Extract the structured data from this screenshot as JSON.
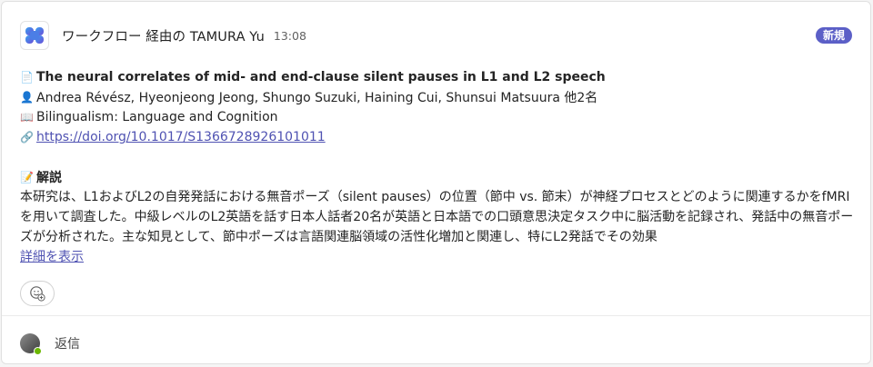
{
  "header": {
    "sender": "ワークフロー 経由の TAMURA Yu",
    "time": "13:08",
    "badge": "新規",
    "app_icon": "workflow-app-icon"
  },
  "paper": {
    "title_icon": "📄",
    "title": "The neural correlates of mid- and end-clause silent pauses in L1 and L2 speech",
    "authors_icon": "👤",
    "authors": "Andrea Révész, Hyeonjeong Jeong, Shungo Suzuki, Haining Cui, Shunsui Matsuura 他2名",
    "journal_icon": "📖",
    "journal": "Bilingualism: Language and Cognition",
    "link_icon": "🔗",
    "doi": "https://doi.org/10.1017/S1366728926101011"
  },
  "summary": {
    "heading_icon": "📝",
    "heading": "解説",
    "text": "本研究は、L1およびL2の自発発話における無音ポーズ（silent pauses）の位置（節中 vs. 節末）が神経プロセスとどのように関連するかをfMRIを用いて調査した。中級レベルのL2英語を話す日本人話者20名が英語と日本語での口頭意思決定タスク中に脳活動を記録され、発話中の無音ポーズが分析された。主な知見として、節中ポーズは言語関連脳領域の活性化増加と関連し、特にL2発話でその効果",
    "show_more": "詳細を表示"
  },
  "footer": {
    "reply_label": "返信"
  },
  "colors": {
    "accent": "#5b5fc7",
    "link": "#4f52b2",
    "presence": "#6bb700"
  }
}
